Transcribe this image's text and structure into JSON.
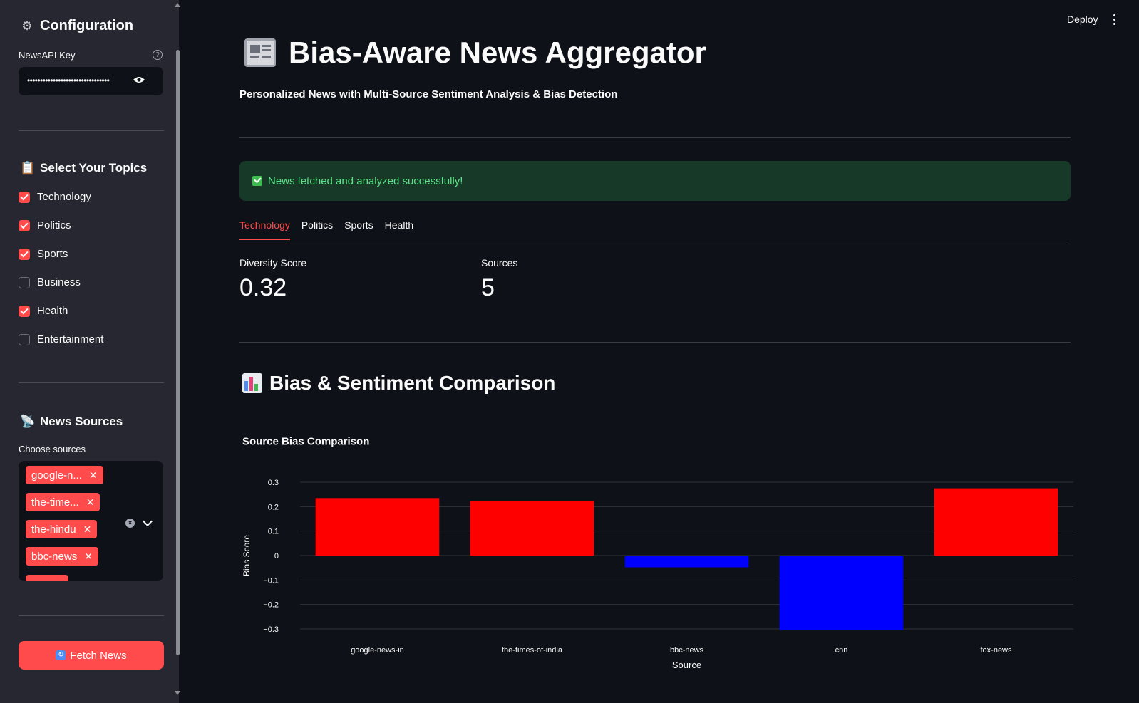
{
  "sidebar": {
    "config_title": "Configuration",
    "api_key_label": "NewsAPI Key",
    "api_key_masked": "••••••••••••••••••••••••••••••••",
    "topics_title": "Select Your Topics",
    "topics": [
      {
        "label": "Technology",
        "checked": true
      },
      {
        "label": "Politics",
        "checked": true
      },
      {
        "label": "Sports",
        "checked": true
      },
      {
        "label": "Business",
        "checked": false
      },
      {
        "label": "Health",
        "checked": true
      },
      {
        "label": "Entertainment",
        "checked": false
      }
    ],
    "sources_title": "News Sources",
    "sources_label": "Choose sources",
    "source_tags": [
      "google-n...",
      "the-time...",
      "the-hindu",
      "bbc-news"
    ],
    "fetch_label": "Fetch News"
  },
  "header": {
    "deploy_label": "Deploy"
  },
  "main": {
    "title": "Bias-Aware News Aggregator",
    "subtitle": "Personalized News with Multi-Source Sentiment Analysis & Bias Detection",
    "success_msg": "News fetched and analyzed successfully!",
    "tabs": [
      "Technology",
      "Politics",
      "Sports",
      "Health"
    ],
    "active_tab": "Technology",
    "metrics": [
      {
        "label": "Diversity Score",
        "value": "0.32"
      },
      {
        "label": "Sources",
        "value": "5"
      }
    ],
    "section_title": "Bias & Sentiment Comparison"
  },
  "chart_data": {
    "type": "bar",
    "title": "Source Bias Comparison",
    "xlabel": "Source",
    "ylabel": "Bias Score",
    "categories": [
      "google-news-in",
      "the-times-of-india",
      "bbc-news",
      "cnn",
      "fox-news"
    ],
    "values": [
      0.235,
      0.222,
      -0.048,
      -0.305,
      0.275
    ],
    "ylim": [
      -0.3,
      0.3
    ],
    "yticks": [
      "0.3",
      "0.2",
      "0.1",
      "0",
      "−0.1",
      "−0.2",
      "−0.3"
    ],
    "positive_color": "#ff0000",
    "negative_color": "#0000ff",
    "grid": true
  }
}
